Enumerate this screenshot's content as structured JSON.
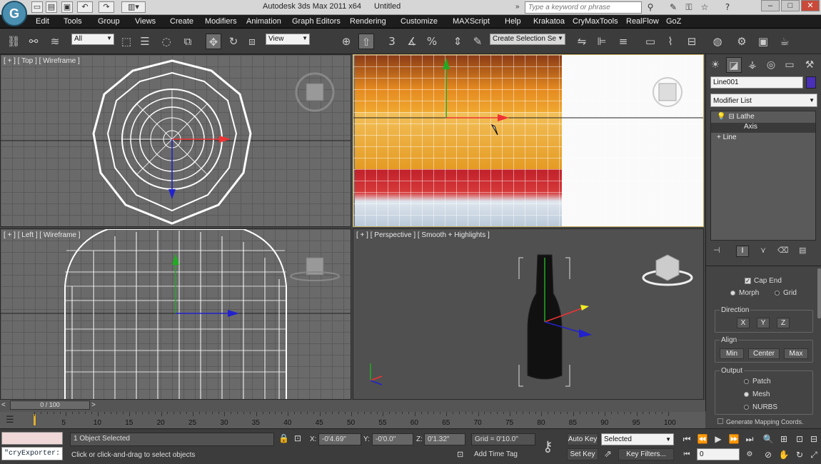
{
  "titlebar": {
    "app_title": "Autodesk 3ds Max  2011 x64",
    "doc_title": "Untitled",
    "search_placeholder": "Type a keyword or phrase",
    "logo": "G"
  },
  "menus": [
    "Edit",
    "Tools",
    "Group",
    "Views",
    "Create",
    "Modifiers",
    "Animation",
    "Graph Editors",
    "Rendering",
    "Customize",
    "MAXScript",
    "Help",
    "Krakatoa",
    "CryMaxTools",
    "RealFlow",
    "GoZ"
  ],
  "toolbar": {
    "selection_filter": "All",
    "ref_coord": "View",
    "named_selection_placeholder": "Create Selection Se"
  },
  "viewports": {
    "top": "[ + ] [ Top ] [ Wireframe ]",
    "left": "[ + ] [ Left ] [ Wireframe ]",
    "perspective": "[ + ] [ Perspective ] [ Smooth + Highlights ]"
  },
  "command_panel": {
    "object_name": "Line001",
    "modifier_list": "Modifier List",
    "stack": [
      {
        "label": "Lathe",
        "prefix": "⊟"
      },
      {
        "label": "Axis",
        "prefix": ""
      },
      {
        "label": "Line",
        "prefix": "+"
      }
    ],
    "cap_end": "Cap End",
    "morph": "Morph",
    "grid": "Grid",
    "direction_title": "Direction",
    "dir_x": "X",
    "dir_y": "Y",
    "dir_z": "Z",
    "align_title": "Align",
    "align_min": "Min",
    "align_center": "Center",
    "align_max": "Max",
    "output_title": "Output",
    "out_patch": "Patch",
    "out_mesh": "Mesh",
    "out_nurbs": "NURBS",
    "gen_map": "Generate Mapping Coords."
  },
  "timeline": {
    "slider": "0 / 100",
    "ticks": [
      "0",
      "5",
      "10",
      "15",
      "20",
      "25",
      "30",
      "35",
      "40",
      "45",
      "50",
      "55",
      "60",
      "65",
      "70",
      "75",
      "80",
      "85",
      "90",
      "95",
      "100"
    ]
  },
  "status": {
    "script_listener": "\"cryExporter:",
    "selection": "1 Object Selected",
    "prompt": "Click or click-and-drag to select objects",
    "x_label": "X:",
    "x_val": "-0'4.69\"",
    "y_label": "Y:",
    "y_val": "-0'0.0\"",
    "z_label": "Z:",
    "z_val": "0'1.32\"",
    "grid": "Grid = 0'10.0\"",
    "add_time_tag": "Add Time Tag",
    "auto_key": "Auto Key",
    "set_key": "Set Key",
    "key_mode": "Selected",
    "key_filters": "Key Filters...",
    "frame": "0"
  }
}
